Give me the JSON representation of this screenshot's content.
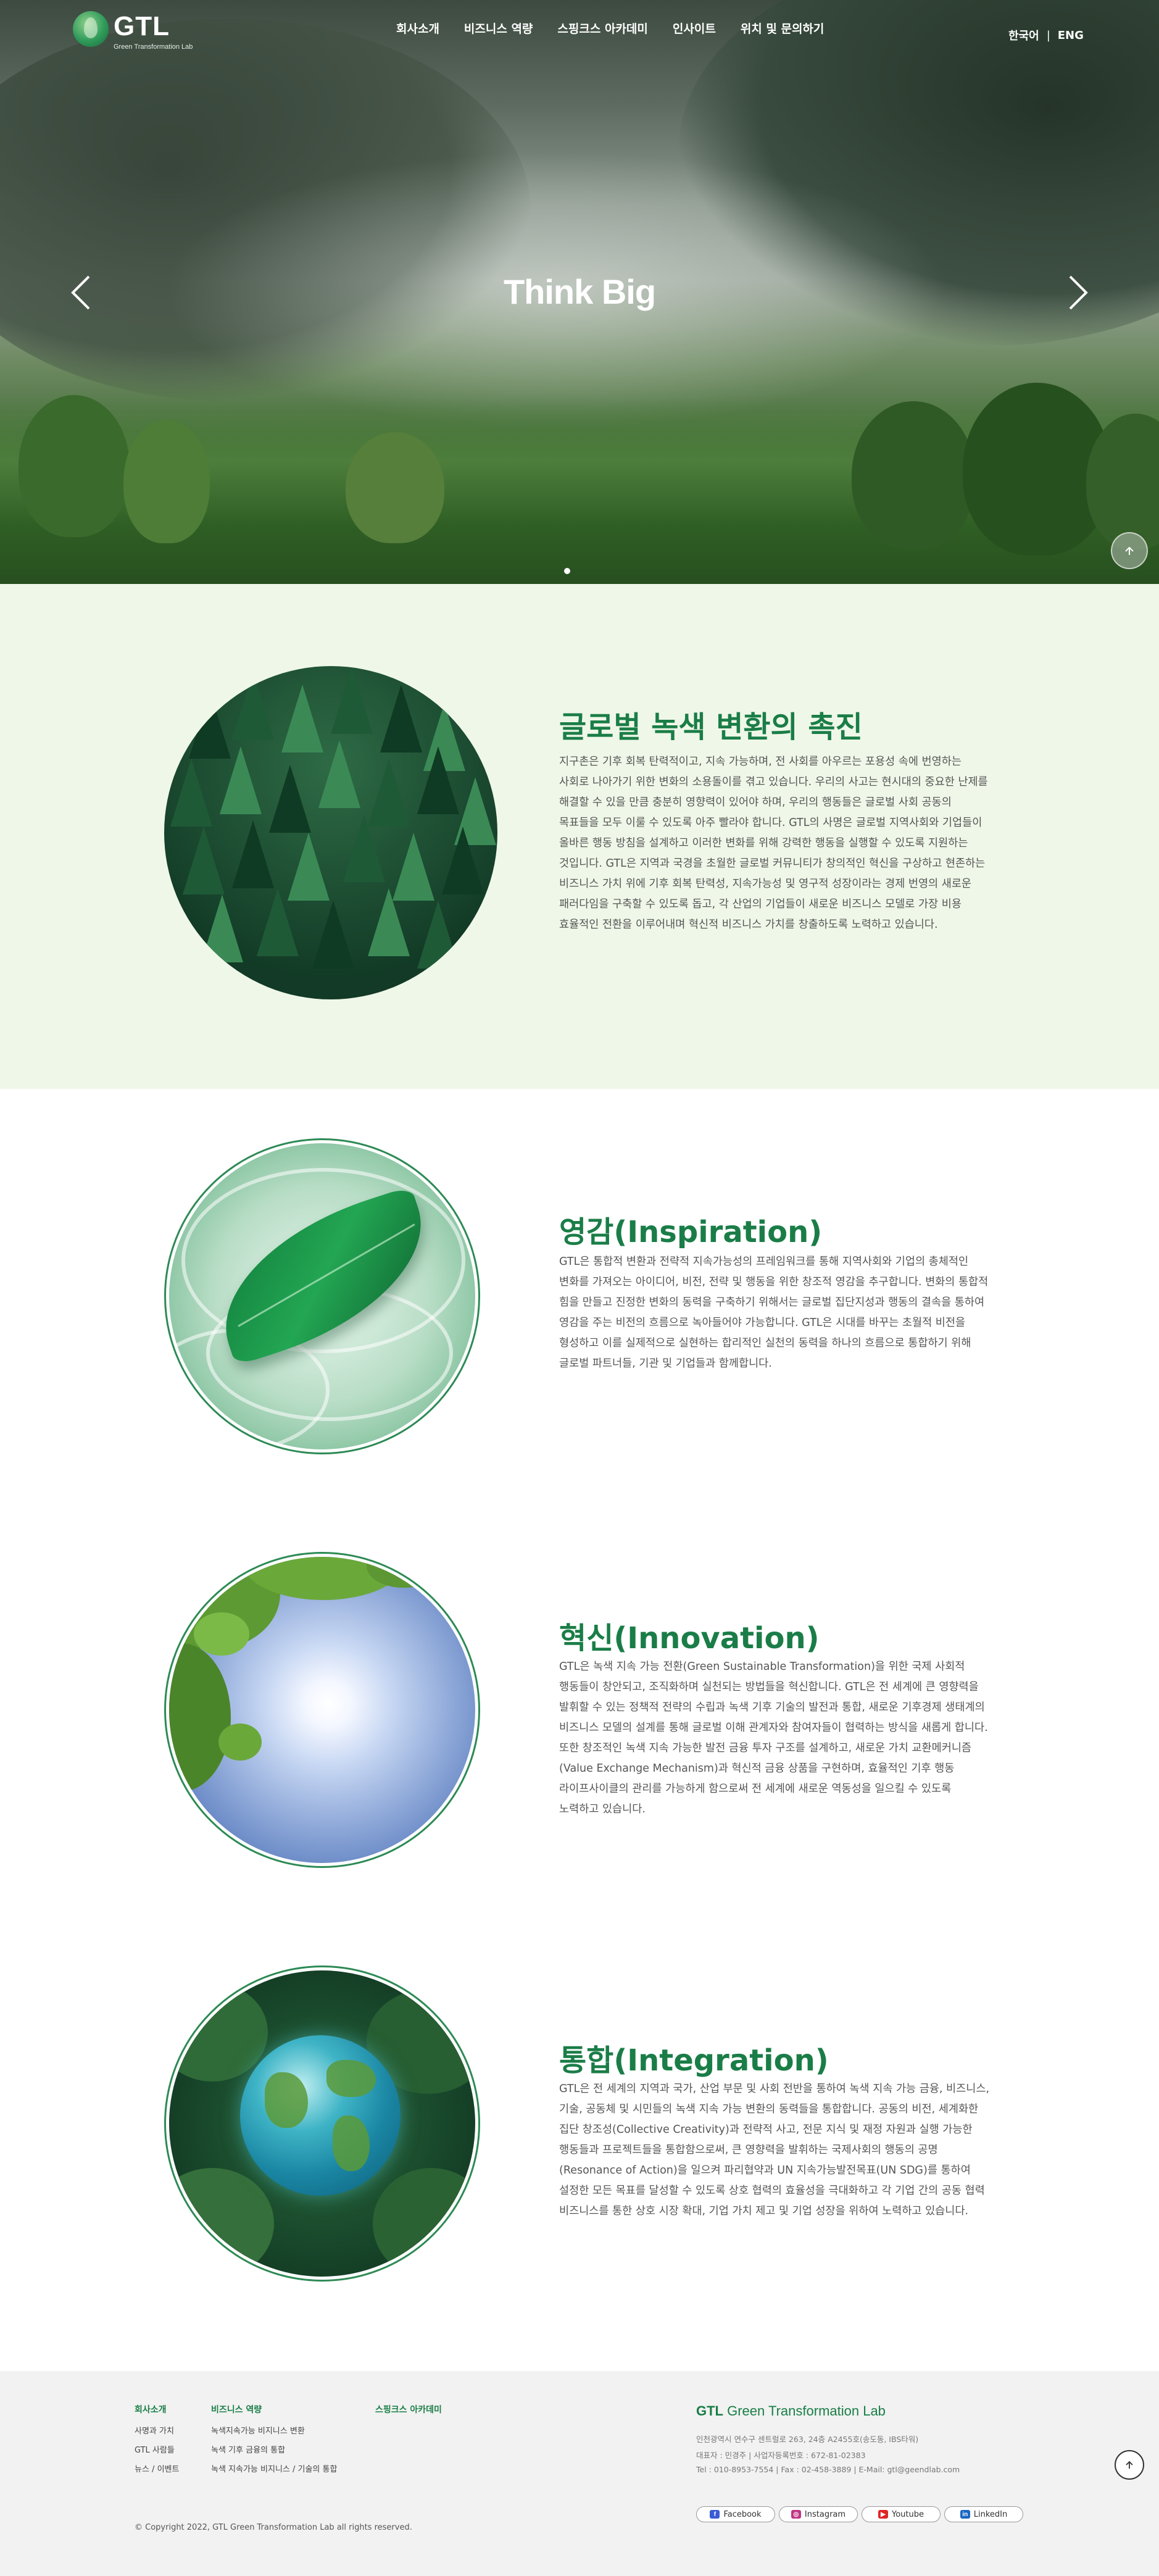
{
  "header": {
    "logo_text": "GTL",
    "logo_subtitle": "Green Transformation Lab",
    "menu": [
      "회사소개",
      "비즈니스 역량",
      "스핑크스 아카데미",
      "인사이트",
      "위치 및 문의하기"
    ],
    "lang_ko": "한국어",
    "lang_separator": "|",
    "lang_en": "ENG"
  },
  "hero": {
    "title": "Think Big"
  },
  "sections": {
    "global": {
      "title": "글로벌 녹색 변환의 촉진",
      "body": "지구촌은 기후 회복 탄력적이고, 지속 가능하며, 전 사회를 아우르는 포용성 속에 번영하는 사회로 나아가기 위한 변화의 소용돌이를 겪고 있습니다. 우리의 사고는 현시대의 중요한 난제를 해결할 수 있을 만큼 충분히 영향력이 있어야 하며, 우리의 행동들은 글로벌 사회 공동의 목표들을 모두 이룰 수 있도록 아주 빨라야 합니다. GTL의 사명은 글로벌 지역사회와 기업들이 올바른 행동 방침을 설계하고 이러한 변화를 위해 강력한 행동을 실행할 수 있도록 지원하는 것입니다. GTL은 지역과 국경을 초월한 글로벌 커뮤니티가 창의적인 혁신을 구상하고 현존하는 비즈니스 가치 위에 기후 회복 탄력성, 지속가능성 및 영구적 성장이라는 경제 번영의 새로운 패러다임을 구축할 수 있도록 돕고, 각 산업의 기업들이 새로운 비즈니스 모델로 가장 비용 효율적인 전환을 이루어내며 혁신적 비즈니스 가치를 창출하도록 노력하고 있습니다."
    },
    "inspiration": {
      "title": "영감(Inspiration)",
      "body": "GTL은 통합적 변환과 전략적 지속가능성의 프레임워크를 통해 지역사회와 기업의 총체적인 변화를 가져오는 아이디어, 비전, 전략 및 행동을 위한 창조적 영감을 추구합니다. 변화의 통합적 힘을 만들고 진정한 변화의 동력을 구축하기 위해서는 글로벌 집단지성과 행동의 결속을 통하여 영감을 주는 비전의 흐름으로 녹아들어야 가능합니다. GTL은 시대를 바꾸는 초월적 비전을 형성하고 이를 실제적으로 실현하는 합리적인 실천의 동력을 하나의 흐름으로 통합하기 위해 글로벌 파트너들, 기관 및 기업들과 함께합니다."
    },
    "innovation": {
      "title": "혁신(Innovation)",
      "body": "GTL은 녹색 지속 가능 전환(Green Sustainable Transformation)을 위한 국제 사회적 행동들이 창안되고, 조직화하며 실천되는 방법들을 혁신합니다. GTL은 전 세계에 큰 영향력을 발휘할 수 있는 정책적 전략의 수립과 녹색 기후 기술의 발전과 통합, 새로운 기후경제 생태계의 비즈니스 모델의 설계를 통해 글로벌 이해 관계자와 참여자들이 협력하는 방식을 새롭게 합니다. 또한 창조적인 녹색 지속 가능한 발전 금융 투자 구조를 설계하고, 새로운 가치 교환메커니즘(Value Exchange Mechanism)과 혁신적 금융 상품을 구현하며, 효율적인 기후 행동 라이프사이클의 관리를 가능하게 함으로써 전 세계에 새로운 역동성을 일으킬 수 있도록 노력하고 있습니다."
    },
    "integration": {
      "title": "통합(Integration)",
      "body": "GTL은 전 세계의 지역과 국가, 산업 부문 및 사회 전반을 통하여 녹색 지속 가능 금융, 비즈니스, 기술, 공동체 및 시민들의 녹색 지속 가능 변환의 동력들을 통합합니다. 공동의 비전, 세계화한 집단 창조성(Collective Creativity)과 전략적 사고, 전문 지식 및 재정 자원과 실행 가능한 행동들과 프로젝트들을 통합함으로써, 큰 영향력을 발휘하는 국제사회의 행동의 공명(Resonance of Action)을 일으켜 파리협약과 UN 지속가능발전목표(UN SDG)를 통하여 설정한 모든 목표를 달성할 수 있도록 상호 협력의 효율성을 극대화하고 각 기업 간의 공동 협력 비즈니스를 통한 상호 시장 확대, 기업 가치 제고 및 기업 성장을 위하여 노력하고 있습니다."
    }
  },
  "footer": {
    "col1": {
      "heading": "회사소개",
      "links": [
        "사명과 가치",
        "GTL 사람들",
        "뉴스 / 이벤트"
      ]
    },
    "col2": {
      "heading": "비즈니스 역량",
      "links": [
        "녹색지속가능 비지니스 변환",
        "녹색 기후 금융의 통합",
        "녹색 지속가능 비지니스 / 기술의 통합"
      ]
    },
    "col3": {
      "heading": "스핑크스 아카데미"
    },
    "brand_bold": "GTL",
    "brand_rest": " Green Transformation Lab",
    "address": "인천광역시 연수구 센트럴로 263, 24층 A2455호(송도동, IBS타워)",
    "registration": "대표자 : 민경주 | 사업자등록번호 : 672-81-02383",
    "contact": "Tel : 010-8953-7554 | Fax : 02-458-3889 | E-Mail: gtl@geendlab.com",
    "copyright": "© Copyright 2022, GTL Green Transformation Lab all rights reserved.",
    "social": [
      "Facebook",
      "Instagram",
      "Youtube",
      "LinkedIn"
    ]
  },
  "colors": {
    "brand_green": "#1a7d47",
    "section_bg": "#eff7e8",
    "footer_bg": "#f1f2f1"
  }
}
